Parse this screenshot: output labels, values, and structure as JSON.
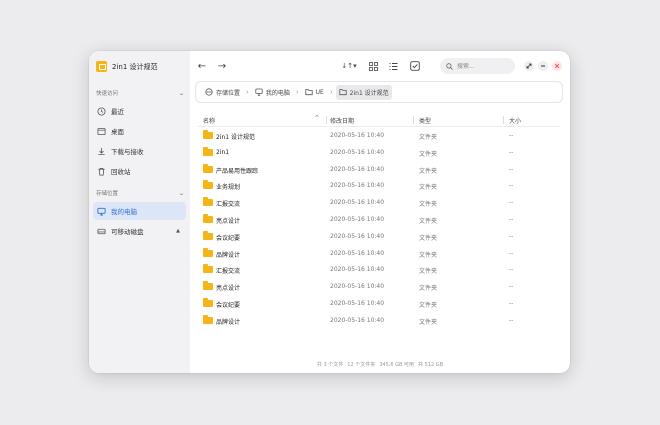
{
  "app": {
    "title": "2in1 设计规范"
  },
  "sidebar": {
    "quick_access_label": "快速访问",
    "quick_items": [
      {
        "label": "最近",
        "icon": "clock-icon"
      },
      {
        "label": "桌面",
        "icon": "desktop-icon"
      },
      {
        "label": "下载与接收",
        "icon": "download-icon"
      },
      {
        "label": "回收站",
        "icon": "trash-icon"
      }
    ],
    "storage_label": "存储位置",
    "storage_items": [
      {
        "label": "我的电脑",
        "icon": "monitor-icon",
        "active": true
      },
      {
        "label": "可移动磁盘",
        "icon": "drive-icon",
        "eject": "▲"
      }
    ]
  },
  "toolbar": {
    "back": "←",
    "forward": "→",
    "sort": "↓↑▾",
    "search_placeholder": "搜索..."
  },
  "breadcrumb": [
    {
      "label": "存储位置",
      "icon": "storage-icon"
    },
    {
      "label": "我的电脑",
      "icon": "monitor-icon"
    },
    {
      "label": "UE",
      "icon": "folder-outline-icon"
    },
    {
      "label": "2in1 设计规范",
      "icon": "folder-outline-icon",
      "current": true
    }
  ],
  "table": {
    "headers": {
      "name": "名称",
      "date": "修改日期",
      "type": "类型",
      "size": "大小"
    },
    "rows": [
      {
        "name": "2in1 设计规范",
        "date": "2020-05-16  10:40",
        "type": "文件夹",
        "size": "--"
      },
      {
        "name": "2in1",
        "date": "2020-05-16  10:40",
        "type": "文件夹",
        "size": "--"
      },
      {
        "name": "产品易用性跟踪",
        "date": "2020-05-16  10:40",
        "type": "文件夹",
        "size": "--"
      },
      {
        "name": "业务规划",
        "date": "2020-05-16  10:40",
        "type": "文件夹",
        "size": "--"
      },
      {
        "name": "汇报交流",
        "date": "2020-05-16  10:40",
        "type": "文件夹",
        "size": "--"
      },
      {
        "name": "亮点设计",
        "date": "2020-05-16  10:40",
        "type": "文件夹",
        "size": "--"
      },
      {
        "name": "会议纪要",
        "date": "2020-05-16  10:40",
        "type": "文件夹",
        "size": "--"
      },
      {
        "name": "品牌设计",
        "date": "2020-05-16  10:40",
        "type": "文件夹",
        "size": "--"
      },
      {
        "name": "汇报交流",
        "date": "2020-05-16  10:40",
        "type": "文件夹",
        "size": "--"
      },
      {
        "name": "亮点设计",
        "date": "2020-05-16  10:40",
        "type": "文件夹",
        "size": "--"
      },
      {
        "name": "会议纪要",
        "date": "2020-05-16  10:40",
        "type": "文件夹",
        "size": "--"
      },
      {
        "name": "品牌设计",
        "date": "2020-05-16  10:40",
        "type": "文件夹",
        "size": "--"
      }
    ]
  },
  "status": {
    "items": "共 3 个文件",
    "folders": "12 个文件夹",
    "free": "345.6 GB 可用",
    "total": "共 512 GB"
  },
  "colors": {
    "accent": "#2f6fd6",
    "folder": "#f5b418",
    "close": "#e84c4c"
  }
}
